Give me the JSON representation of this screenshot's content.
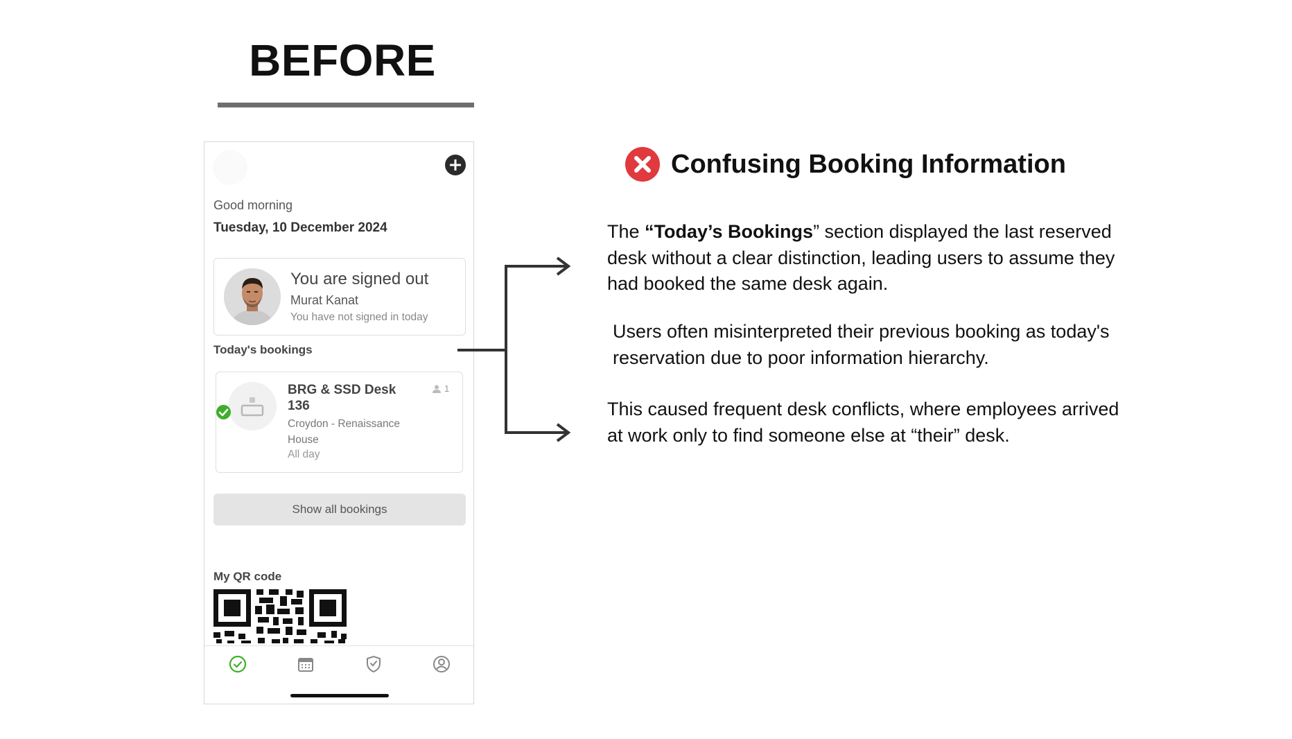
{
  "heading": "BEFORE",
  "phone": {
    "greeting": "Good morning",
    "date": "Tuesday, 10 December 2024",
    "status": {
      "title": "You are signed out",
      "name": "Murat Kanat",
      "subtitle": "You have not signed in today"
    },
    "todays_bookings_label": "Today's bookings",
    "booking": {
      "desk_name": "BRG & SSD Desk 136",
      "location": "Croydon - Renaissance House",
      "time": "All day",
      "attendee_count": "1"
    },
    "show_all_label": "Show all bookings",
    "qr_label": "My QR code",
    "tabs": [
      "check-circle-icon",
      "calendar-icon",
      "shield-icon",
      "user-icon"
    ],
    "accent": "#3fae2a"
  },
  "issue": {
    "title": "Confusing Booking Information",
    "icon_color": "#e0393e"
  },
  "paragraphs": {
    "p1_pre": "The ",
    "p1_bold": "“Today’s Bookings",
    "p1_post": "” section displayed the last reserved desk without a clear distinction, leading users to assume they had booked the same desk again.",
    "p2": "Users often misinterpreted their previous booking as today's reservation due to poor information hierarchy.",
    "p3": "This caused frequent desk conflicts, where employees arrived at work only to find someone else at “their” desk."
  }
}
